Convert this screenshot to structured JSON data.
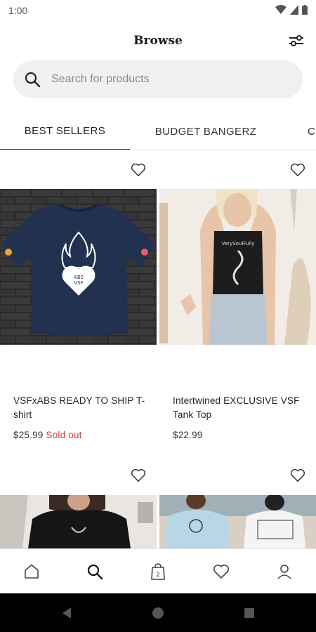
{
  "status_bar": {
    "time": "1:00"
  },
  "header": {
    "title": "Browse"
  },
  "search": {
    "placeholder": "Search for products"
  },
  "tabs": [
    {
      "label": "BEST SELLERS",
      "active": true
    },
    {
      "label": "BUDGET BANGERZ",
      "active": false
    },
    {
      "label": "C",
      "active": false
    }
  ],
  "products": [
    {
      "name": "VSFxABS READY TO SHIP T-shirt",
      "price": "$25.99",
      "status": "Sold out"
    },
    {
      "name": "Intertwined EXCLUSIVE VSF Tank Top",
      "price": "$22.99",
      "status": ""
    },
    {
      "name": "",
      "price": "",
      "status": ""
    },
    {
      "name": "",
      "price": "",
      "status": ""
    }
  ],
  "bottom_nav": {
    "items": [
      {
        "icon": "home-icon",
        "active": false
      },
      {
        "icon": "search-icon",
        "active": true
      },
      {
        "icon": "bag-icon",
        "badge": "2",
        "active": false
      },
      {
        "icon": "heart-icon",
        "active": false
      },
      {
        "icon": "profile-icon",
        "active": false
      }
    ]
  },
  "colors": {
    "sold_out": "#d33a3a",
    "search_bg": "#f0f0f0",
    "navy_shirt": "#22314f"
  }
}
